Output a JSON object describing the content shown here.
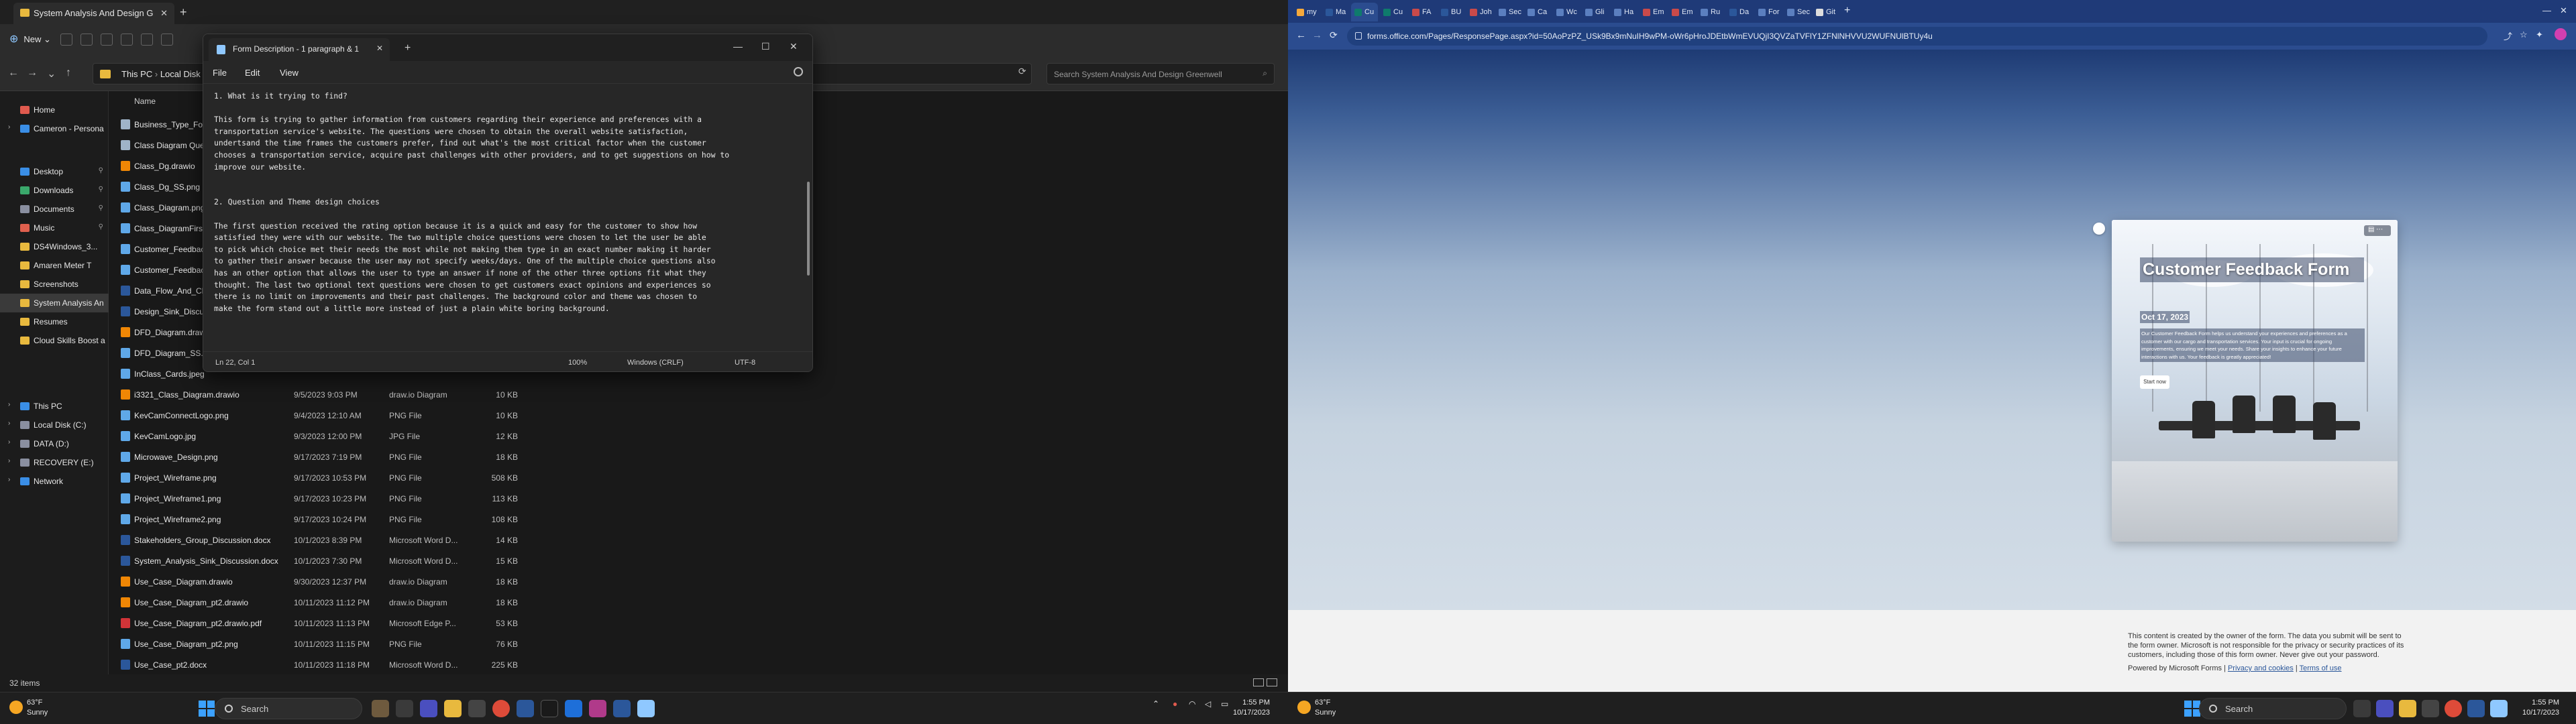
{
  "explorer": {
    "tab_title": "System Analysis And Design G",
    "new_label": "New",
    "address_this_pc": "This PC",
    "address_disk": "Local Disk",
    "search_placeholder": "Search System Analysis And Design Greenwell",
    "column_name": "Name",
    "nav": [
      {
        "label": "Home",
        "icon": "home-icon",
        "color": "#e05a4e"
      },
      {
        "label": "Cameron - Persona",
        "icon": "cloud-icon",
        "color": "#3a8ee6"
      },
      {
        "label": "Desktop",
        "icon": "desktop-icon",
        "color": "#3a8ee6"
      },
      {
        "label": "Downloads",
        "icon": "download-icon",
        "color": "#3aa86b"
      },
      {
        "label": "Documents",
        "icon": "documents-icon",
        "color": "#8a8fa0"
      },
      {
        "label": "Music",
        "icon": "music-icon",
        "color": "#e0604e"
      },
      {
        "label": "DS4Windows_3...",
        "icon": "folder-icon",
        "color": "#e8b93e"
      },
      {
        "label": "Amaren Meter T",
        "icon": "folder-icon",
        "color": "#e8b93e"
      },
      {
        "label": "Screenshots",
        "icon": "folder-icon",
        "color": "#e8b93e"
      },
      {
        "label": "System Analysis An",
        "icon": "folder-icon",
        "color": "#e8b93e"
      },
      {
        "label": "Resumes",
        "icon": "folder-icon",
        "color": "#e8b93e"
      },
      {
        "label": "Cloud Skills Boost a",
        "icon": "folder-icon",
        "color": "#e8b93e"
      },
      {
        "label": "This PC",
        "icon": "pc-icon",
        "color": "#3a8ee6"
      },
      {
        "label": "Local Disk (C:)",
        "icon": "drive-icon",
        "color": "#8a8fa0"
      },
      {
        "label": "DATA (D:)",
        "icon": "drive-icon",
        "color": "#8a8fa0"
      },
      {
        "label": "RECOVERY (E:)",
        "icon": "drive-icon",
        "color": "#8a8fa0"
      },
      {
        "label": "Network",
        "icon": "network-icon",
        "color": "#3a8ee6"
      }
    ],
    "files": [
      {
        "name": "Business_Type_Fo",
        "date": "",
        "type": "",
        "size": "",
        "color": "#9fb3c8"
      },
      {
        "name": "Class Diagram Ques",
        "date": "",
        "type": "",
        "size": "",
        "color": "#9fb3c8"
      },
      {
        "name": "Class_Dg.drawio",
        "date": "",
        "type": "",
        "size": "",
        "color": "#f08705"
      },
      {
        "name": "Class_Dg_SS.png",
        "date": "",
        "type": "",
        "size": "",
        "color": "#5fa8e8"
      },
      {
        "name": "Class_Diagram.png",
        "date": "",
        "type": "",
        "size": "",
        "color": "#5fa8e8"
      },
      {
        "name": "Class_DiagramFirst.p",
        "date": "",
        "type": "",
        "size": "",
        "color": "#5fa8e8"
      },
      {
        "name": "Customer_Feedback",
        "date": "",
        "type": "",
        "size": "",
        "color": "#5fa8e8"
      },
      {
        "name": "Customer_Feedback",
        "date": "",
        "type": "",
        "size": "",
        "color": "#5fa8e8"
      },
      {
        "name": "Data_Flow_And_Cla",
        "date": "",
        "type": "",
        "size": "",
        "color": "#2b579a"
      },
      {
        "name": "Design_Sink_Discus",
        "date": "",
        "type": "",
        "size": "",
        "color": "#2b579a"
      },
      {
        "name": "DFD_Diagram.drawi",
        "date": "",
        "type": "",
        "size": "",
        "color": "#f08705"
      },
      {
        "name": "DFD_Diagram_SS.pn",
        "date": "",
        "type": "",
        "size": "",
        "color": "#5fa8e8"
      },
      {
        "name": "InClass_Cards.jpeg",
        "date": "",
        "type": "",
        "size": "",
        "color": "#5fa8e8"
      },
      {
        "name": "i3321_Class_Diagram.drawio",
        "date": "9/5/2023 9:03 PM",
        "type": "draw.io Diagram",
        "size": "10 KB",
        "color": "#f08705"
      },
      {
        "name": "KevCamConnectLogo.png",
        "date": "9/4/2023 12:10 AM",
        "type": "PNG File",
        "size": "10 KB",
        "color": "#5fa8e8"
      },
      {
        "name": "KevCamLogo.jpg",
        "date": "9/3/2023 12:00 PM",
        "type": "JPG File",
        "size": "12 KB",
        "color": "#5fa8e8"
      },
      {
        "name": "Microwave_Design.png",
        "date": "9/17/2023 7:19 PM",
        "type": "PNG File",
        "size": "18 KB",
        "color": "#5fa8e8"
      },
      {
        "name": "Project_Wireframe.png",
        "date": "9/17/2023 10:53 PM",
        "type": "PNG File",
        "size": "508 KB",
        "color": "#5fa8e8"
      },
      {
        "name": "Project_Wireframe1.png",
        "date": "9/17/2023 10:23 PM",
        "type": "PNG File",
        "size": "113 KB",
        "color": "#5fa8e8"
      },
      {
        "name": "Project_Wireframe2.png",
        "date": "9/17/2023 10:24 PM",
        "type": "PNG File",
        "size": "108 KB",
        "color": "#5fa8e8"
      },
      {
        "name": "Stakeholders_Group_Discussion.docx",
        "date": "10/1/2023 8:39 PM",
        "type": "Microsoft Word D...",
        "size": "14 KB",
        "color": "#2b579a"
      },
      {
        "name": "System_Analysis_Sink_Discussion.docx",
        "date": "10/1/2023 7:30 PM",
        "type": "Microsoft Word D...",
        "size": "15 KB",
        "color": "#2b579a"
      },
      {
        "name": "Use_Case_Diagram.drawio",
        "date": "9/30/2023 12:37 PM",
        "type": "draw.io Diagram",
        "size": "18 KB",
        "color": "#f08705"
      },
      {
        "name": "Use_Case_Diagram_pt2.drawio",
        "date": "10/11/2023 11:12 PM",
        "type": "draw.io Diagram",
        "size": "18 KB",
        "color": "#f08705"
      },
      {
        "name": "Use_Case_Diagram_pt2.drawio.pdf",
        "date": "10/11/2023 11:13 PM",
        "type": "Microsoft Edge P...",
        "size": "53 KB",
        "color": "#d13438"
      },
      {
        "name": "Use_Case_Diagram_pt2.png",
        "date": "10/11/2023 11:15 PM",
        "type": "PNG File",
        "size": "76 KB",
        "color": "#5fa8e8"
      },
      {
        "name": "Use_Case_pt2.docx",
        "date": "10/11/2023 11:18 PM",
        "type": "Microsoft Word D...",
        "size": "225 KB",
        "color": "#2b579a"
      }
    ],
    "status": "32 items"
  },
  "notepad": {
    "tab_title": "Form Description - 1 paragraph & 1",
    "menu": [
      "File",
      "Edit",
      "View"
    ],
    "text": "1. What is it trying to find?\n\nThis form is trying to gather information from customers regarding their experience and preferences with a\ntransportation service's website. The questions were chosen to obtain the overall website satisfaction,\nundertsand the time frames the customers prefer, find out what's the most critical factor when the customer\nchooses a transportation service, acquire past challenges with other providers, and to get suggestions on how to\nimprove our website.\n\n\n2. Question and Theme design choices\n\nThe first question received the rating option because it is a quick and easy for the customer to show how\nsatisfied they were with our website. The two multiple choice questions were chosen to let the user be able\nto pick which choice met their needs the most while not making them type in an exact number making it harder\nto gather their answer because the user may not specify weeks/days. One of the multiple choice questions also\nhas an other option that allows the user to type an answer if none of the other three options fit what they\nthought. The last two optional text questions were chosen to get customers exact opinions and experiences so\nthere is no limit on improvements and their past challenges. The background color and theme was chosen to\nmake the form stand out a little more instead of just a plain white boring background.",
    "status_pos": "Ln 22, Col 1",
    "status_zoom": "100%",
    "status_eol": "Windows (CRLF)",
    "status_enc": "UTF-8"
  },
  "browser": {
    "tabs": [
      {
        "label": "my",
        "color": "#f7a93b"
      },
      {
        "label": "Ma",
        "color": "#2b579a"
      },
      {
        "label": "Cu",
        "color": "#0f7b6c",
        "active": true
      },
      {
        "label": "Cu",
        "color": "#0f7b6c"
      },
      {
        "label": "FA",
        "color": "#c94a4a"
      },
      {
        "label": "BU",
        "color": "#2b579a"
      },
      {
        "label": "Joh",
        "color": "#c94a4a"
      },
      {
        "label": "Sec",
        "color": "#5b7fbf"
      },
      {
        "label": "Ca",
        "color": "#5b7fbf"
      },
      {
        "label": "Wc",
        "color": "#5b7fbf"
      },
      {
        "label": "Gli",
        "color": "#5b7fbf"
      },
      {
        "label": "Ha",
        "color": "#5b7fbf"
      },
      {
        "label": "Em",
        "color": "#c94a4a"
      },
      {
        "label": "Em",
        "color": "#c94a4a"
      },
      {
        "label": "Ru",
        "color": "#5b7fbf"
      },
      {
        "label": "Da",
        "color": "#2b579a"
      },
      {
        "label": "For",
        "color": "#5b7fbf"
      },
      {
        "label": "Sec",
        "color": "#5b7fbf"
      },
      {
        "label": "Git",
        "color": "#dddddd"
      }
    ],
    "url": "forms.office.com/Pages/ResponsePage.aspx?id=50AoPzPZ_USk9Bx9mNuIH9wPM-oWr6pHroJDEtbWmEVUQjI3QVZaTVFlY1ZFNlNHVVU2WUFNUlBTUy4u",
    "form_title": "Customer Feedback Form",
    "form_date": "Oct 17, 2023",
    "form_desc": "Our Customer Feedback Form helps us understand your experiences and preferences as a customer with our cargo and transportation services. Your input is crucial for ongoing improvements, ensuring we meet your needs. Share your insights to enhance your future interactions with us. Your feedback is greatly appreciated!",
    "start_label": "Start now",
    "footer_notice": "This content is created by the owner of the form. The data you submit will be sent to the form owner. Microsoft is not responsible for the privacy or security practices of its customers, including those of this form owner. Never give out your password.",
    "powered_by": "Powered by Microsoft Forms |",
    "privacy_link": "Privacy and cookies",
    "terms_link": "Terms of use"
  },
  "taskbar": {
    "weather_temp": "63°F",
    "weather_desc": "Sunny",
    "search_label": "Search",
    "time": "1:55 PM",
    "date": "10/17/2023"
  }
}
